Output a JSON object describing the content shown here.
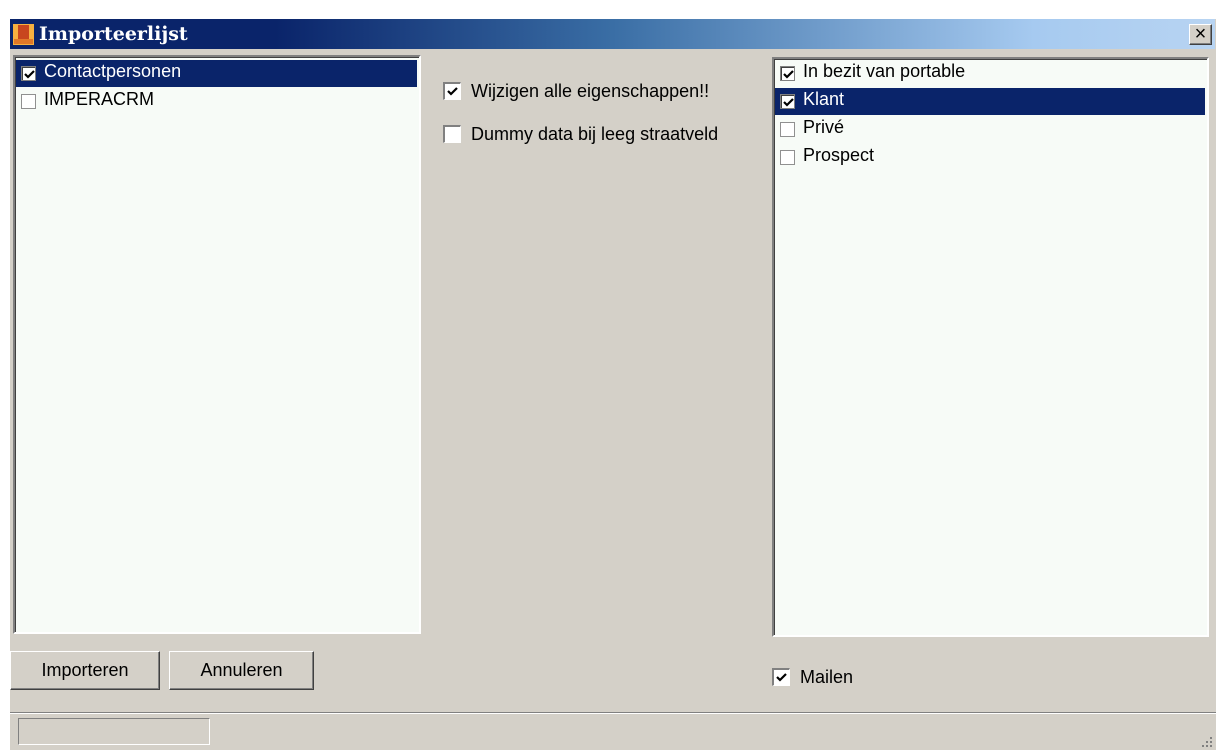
{
  "window": {
    "title": "Importeerlijst",
    "close_label": "×"
  },
  "left_list": {
    "items": [
      {
        "label": "Contactpersonen",
        "checked": true,
        "selected": true
      },
      {
        "label": "IMPERACRM",
        "checked": false,
        "selected": false
      }
    ]
  },
  "options": {
    "wijzigen_label": "Wijzigen alle eigenschappen!!",
    "wijzigen_checked": true,
    "dummy_label": "Dummy data bij leeg straatveld",
    "dummy_checked": false
  },
  "right_list": {
    "items": [
      {
        "label": "In bezit van portable",
        "checked": true,
        "selected": false
      },
      {
        "label": "Klant",
        "checked": true,
        "selected": true
      },
      {
        "label": "Privé",
        "checked": false,
        "selected": false
      },
      {
        "label": "Prospect",
        "checked": false,
        "selected": false
      }
    ]
  },
  "buttons": {
    "import_label": "Importeren",
    "cancel_label": "Annuleren"
  },
  "mail": {
    "label": "Mailen",
    "checked": true
  },
  "colors": {
    "selection": "#0a246a",
    "face": "#d4d0c8",
    "list_background": "#f7fbf7"
  }
}
